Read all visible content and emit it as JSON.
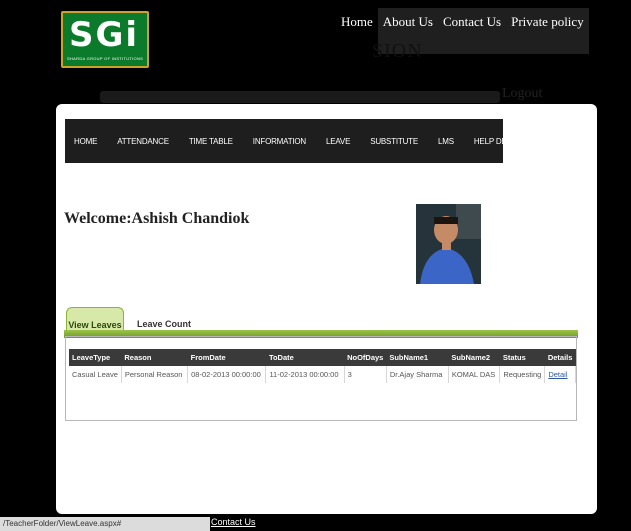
{
  "logo": {
    "brand": "SGi",
    "tagline": "SHARDA GROUP OF INSTITUTIONS"
  },
  "topnav": [
    "Home",
    "About Us",
    "Contact Us",
    "Private policy"
  ],
  "ghost": {
    "line1": "SION",
    "line2": "Logout"
  },
  "mainnav": [
    "HOME",
    "ATTENDANCE",
    "TIME TABLE",
    "INFORMATION",
    "LEAVE",
    "SUBSTITUTE",
    "LMS",
    "HELP DESK"
  ],
  "welcome": "Welcome:Ashish Chandiok",
  "tabs": [
    "View Leaves",
    "Leave Count"
  ],
  "table": {
    "headers": [
      "LeaveType",
      "Reason",
      "FromDate",
      "ToDate",
      "NoOfDays",
      "SubName1",
      "SubName2",
      "Status",
      "Details"
    ],
    "rows": [
      [
        "Casual Leave",
        "Personal Reason",
        "08-02-2013 00:00:00",
        "11-02-2013 00:00:00",
        "3",
        "Dr.Ajay Sharma",
        "KOMAL DAS",
        "Requesting",
        "Detail"
      ]
    ]
  },
  "statusbar": "/TeacherFolder/ViewLeave.aspx#",
  "footer_link": "Contact Us"
}
